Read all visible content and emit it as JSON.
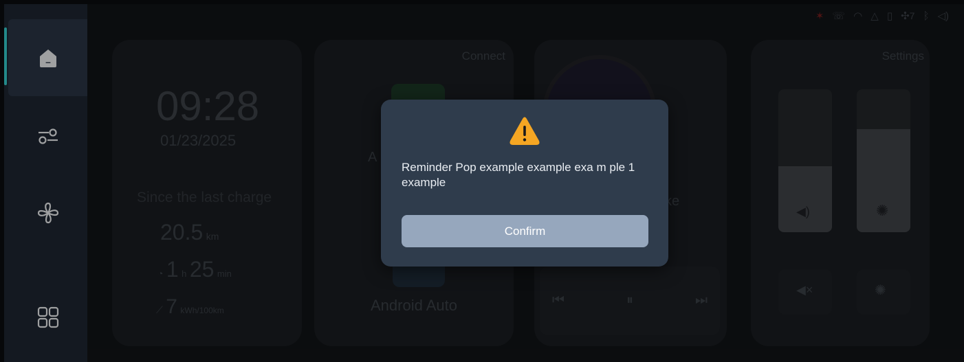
{
  "sidebar": {
    "items": [
      {
        "name": "home",
        "icon": "home-icon",
        "active": true
      },
      {
        "name": "controls",
        "icon": "sliders-icon",
        "active": false
      },
      {
        "name": "climate",
        "icon": "fan-icon",
        "active": false
      },
      {
        "name": "apps",
        "icon": "grid-icon",
        "active": false
      }
    ]
  },
  "status_bar": {
    "icons": [
      "charging-cable-icon",
      "phone-icon",
      "wifi-icon",
      "notification-off-icon",
      "usb-icon",
      "fan-icon",
      "bluetooth-icon",
      "volume-icon"
    ],
    "fan_level": "7"
  },
  "background": {
    "clock": {
      "time": "09:28",
      "date": "01/23/2025"
    },
    "trip": {
      "title": "Since the last charge",
      "distance_value": "20.5",
      "distance_unit": "km",
      "duration_hours": "1",
      "duration_hours_unit": "h",
      "duration_minutes": "25",
      "duration_minutes_unit": "min",
      "consumption_value": "7",
      "consumption_unit": "kWh/100km"
    },
    "connect": {
      "title": "Connect",
      "partial_label": "A",
      "android_auto": "Android Auto"
    },
    "media": {
      "partial_text": "ke"
    },
    "settings": {
      "title": "Settings"
    }
  },
  "dialog": {
    "icon": "warning-icon",
    "message": "Reminder Pop example example exa m ple 1 example",
    "confirm_label": "Confirm"
  },
  "colors": {
    "accent": "#37d3d5",
    "warning": "#f5a623",
    "dialog_bg": "#2f3c4c",
    "button_bg": "#96a7bd",
    "sidebar_bg": "#1f2733"
  }
}
